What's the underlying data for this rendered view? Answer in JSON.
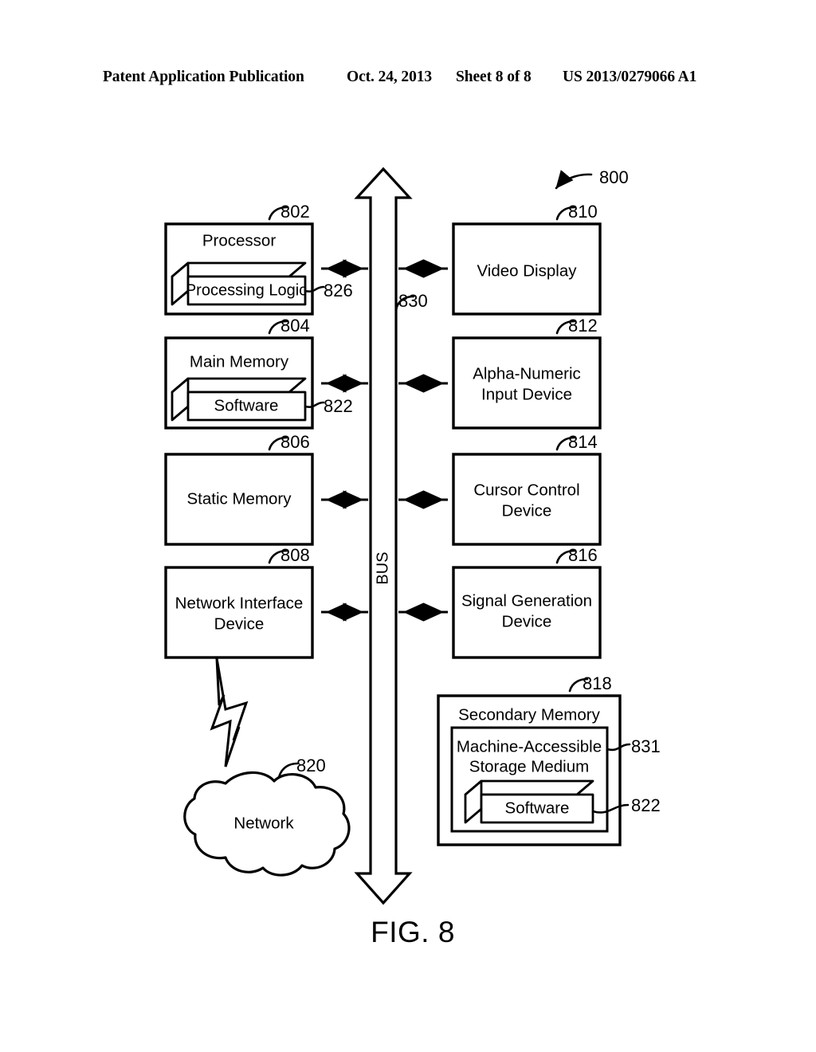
{
  "header": {
    "publication": "Patent Application Publication",
    "date": "Oct. 24, 2013",
    "sheet": "Sheet 8 of 8",
    "number": "US 2013/0279066 A1"
  },
  "figure": {
    "caption": "FIG. 8",
    "system_ref": "800",
    "bus_label": "BUS",
    "bus_ref": "830",
    "left_column": [
      {
        "ref": "802",
        "title": "Processor",
        "inner_label": "Processing Logic",
        "inner_ref": "826",
        "has_3d_inner": true
      },
      {
        "ref": "804",
        "title": "Main Memory",
        "inner_label": "Software",
        "inner_ref": "822",
        "has_3d_inner": true
      },
      {
        "ref": "806",
        "title": "Static Memory",
        "inner_label": "",
        "inner_ref": "",
        "has_3d_inner": false
      },
      {
        "ref": "808",
        "title": "Network Interface Device",
        "title_line1": "Network Interface",
        "title_line2": "Device",
        "inner_label": "",
        "inner_ref": "",
        "has_3d_inner": false
      }
    ],
    "right_column": [
      {
        "ref": "810",
        "title": "Video Display",
        "title_line1": "Video Display",
        "title_line2": ""
      },
      {
        "ref": "812",
        "title": "Alpha-Numeric Input Device",
        "title_line1": "Alpha-Numeric",
        "title_line2": "Input Device"
      },
      {
        "ref": "814",
        "title": "Cursor Control Device",
        "title_line1": "Cursor Control",
        "title_line2": "Device"
      },
      {
        "ref": "816",
        "title": "Signal Generation Device",
        "title_line1": "Signal Generation",
        "title_line2": "Device"
      }
    ],
    "secondary_memory": {
      "ref": "818",
      "title": "Secondary Memory",
      "medium_ref": "831",
      "medium_line1": "Machine-Accessible",
      "medium_line2": "Storage Medium",
      "software_label": "Software",
      "software_ref": "822"
    },
    "network": {
      "ref": "820",
      "label": "Network"
    }
  },
  "colors": {
    "ink": "#000000",
    "paper": "#ffffff"
  }
}
